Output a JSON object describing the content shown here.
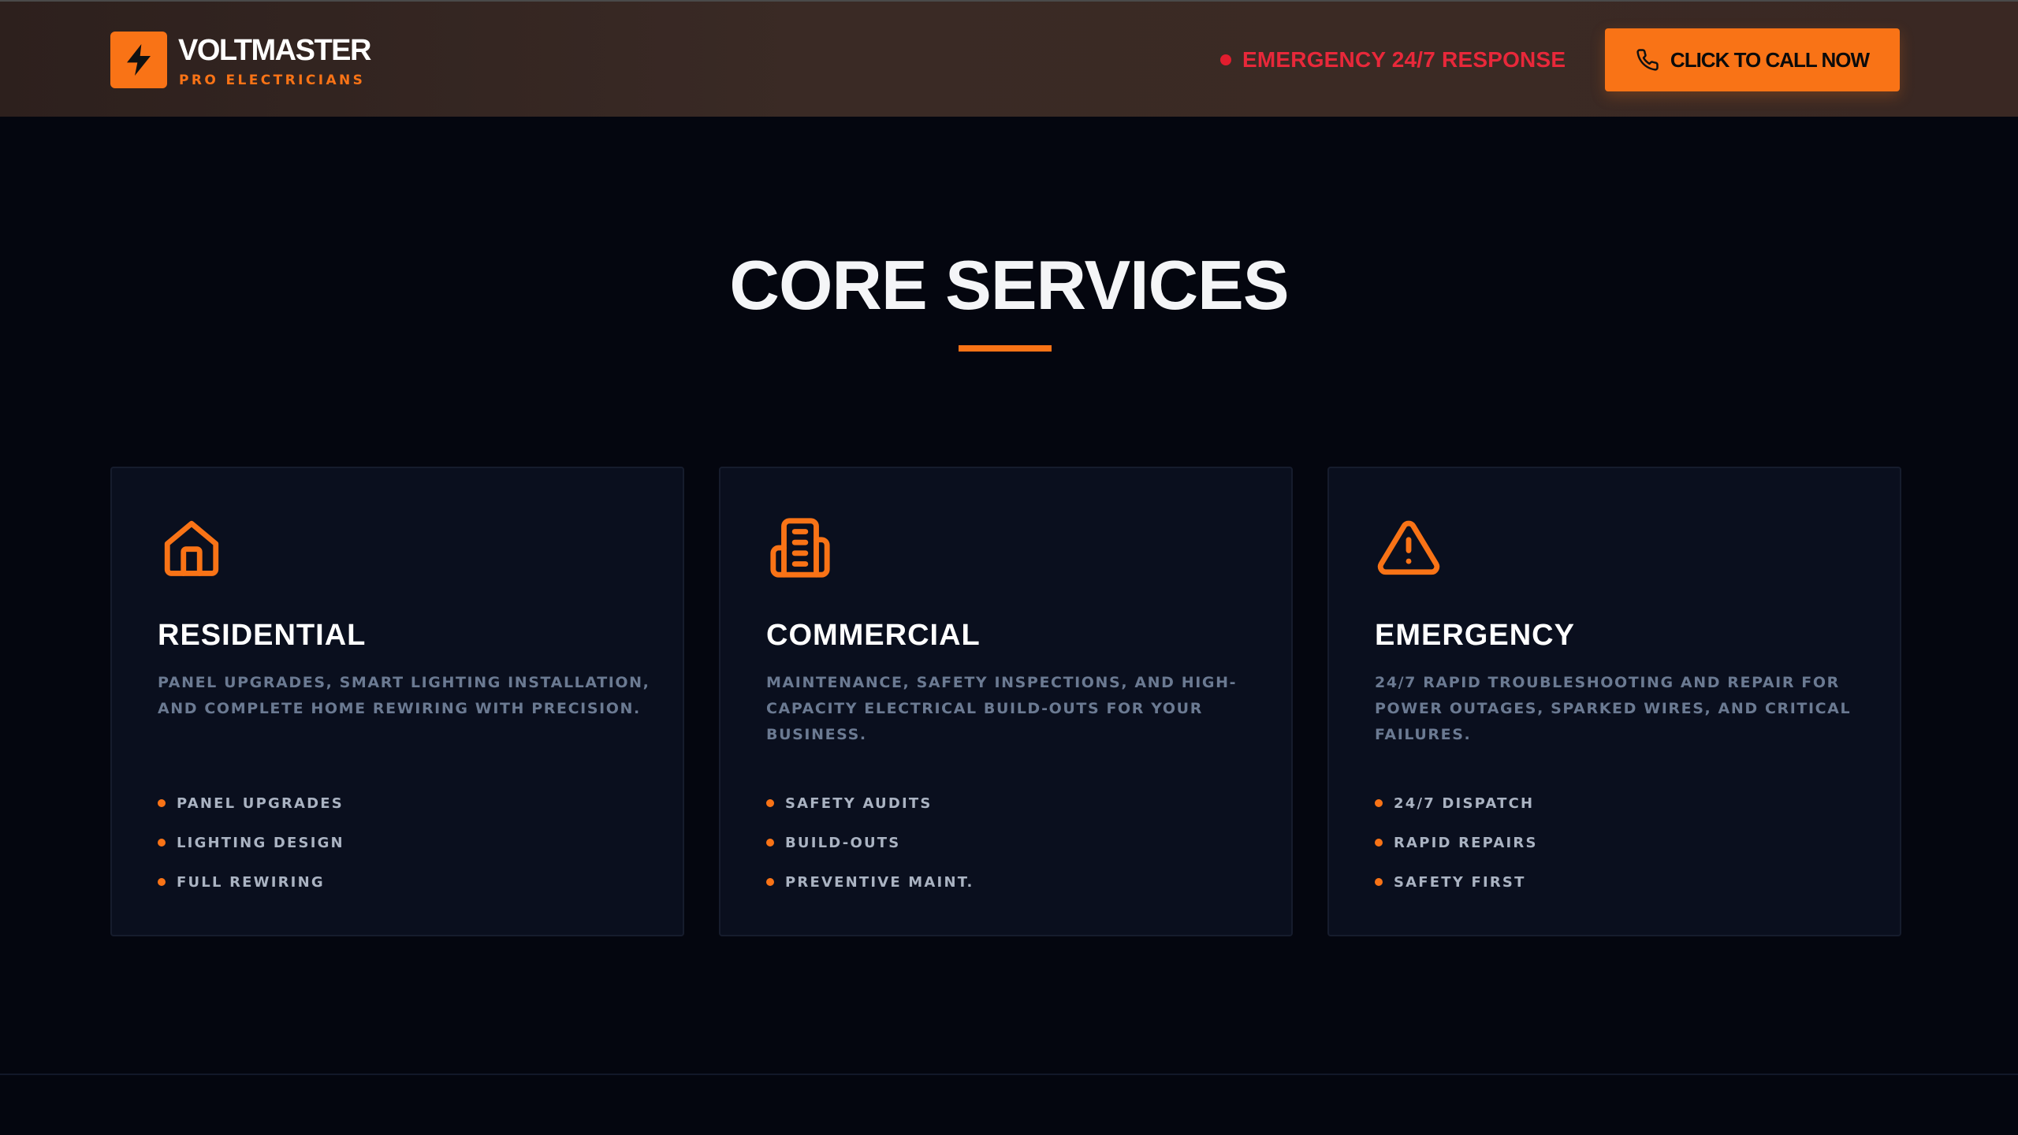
{
  "brand": {
    "name": "VOLTMASTER",
    "tagline": "PRO ELECTRICIANS",
    "accent_color": "#f97316",
    "logo_icon": "lightning-bolt-icon"
  },
  "header": {
    "emergency_text": "EMERGENCY 24/7 RESPONSE",
    "emergency_color": "#e8283a",
    "call_label": "CLICK TO CALL NOW",
    "call_icon": "phone-icon"
  },
  "section": {
    "title": "CORE SERVICES"
  },
  "services": [
    {
      "icon": "house-icon",
      "title": "RESIDENTIAL",
      "description": "PANEL UPGRADES, SMART LIGHTING INSTALLATION, AND COMPLETE HOME REWIRING WITH PRECISION.",
      "features": [
        "PANEL UPGRADES",
        "LIGHTING DESIGN",
        "FULL REWIRING"
      ]
    },
    {
      "icon": "building-icon",
      "title": "COMMERCIAL",
      "description": "MAINTENANCE, SAFETY INSPECTIONS, AND HIGH-CAPACITY ELECTRICAL BUILD-OUTS FOR YOUR BUSINESS.",
      "features": [
        "SAFETY AUDITS",
        "BUILD-OUTS",
        "PREVENTIVE MAINT."
      ]
    },
    {
      "icon": "warning-triangle-icon",
      "title": "EMERGENCY",
      "description": "24/7 RAPID TROUBLESHOOTING AND REPAIR FOR POWER OUTAGES, SPARKED WIRES, AND CRITICAL FAILURES.",
      "features": [
        "24/7 DISPATCH",
        "RAPID REPAIRS",
        "SAFETY FIRST"
      ]
    }
  ]
}
